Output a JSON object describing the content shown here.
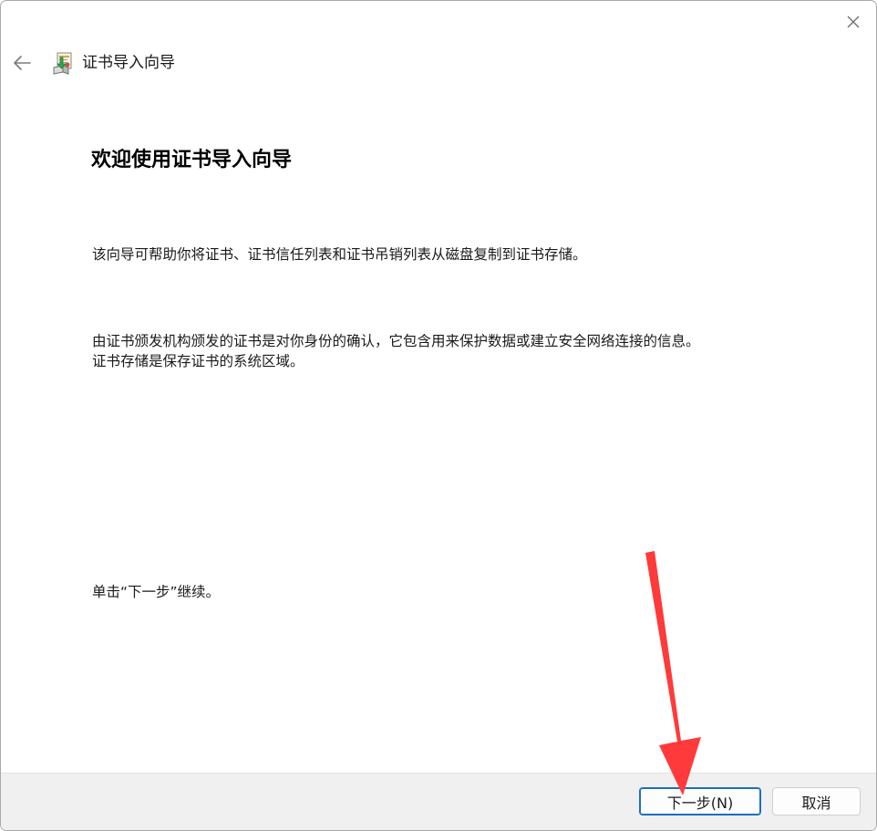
{
  "window": {
    "title": "证书导入向导"
  },
  "content": {
    "heading": "欢迎使用证书导入向导",
    "paragraph1": "该向导可帮助你将证书、证书信任列表和证书吊销列表从磁盘复制到证书存储。",
    "paragraph2_line1": "由证书颁发机构颁发的证书是对你身份的确认，它包含用来保护数据或建立安全网络连接的信息。",
    "paragraph2_line2": "证书存储是保存证书的系统区域。",
    "paragraph3": "单击“下一步”继续。"
  },
  "footer": {
    "next_label": "下一步(N)",
    "cancel_label": "取消"
  },
  "icons": {
    "close": "close-icon",
    "back": "back-arrow-icon",
    "wizard": "certificate-wizard-icon"
  },
  "colors": {
    "accent": "#1b6ec2",
    "annotation_arrow": "#ff3a3a",
    "footer_bg": "#f0f0f0"
  }
}
